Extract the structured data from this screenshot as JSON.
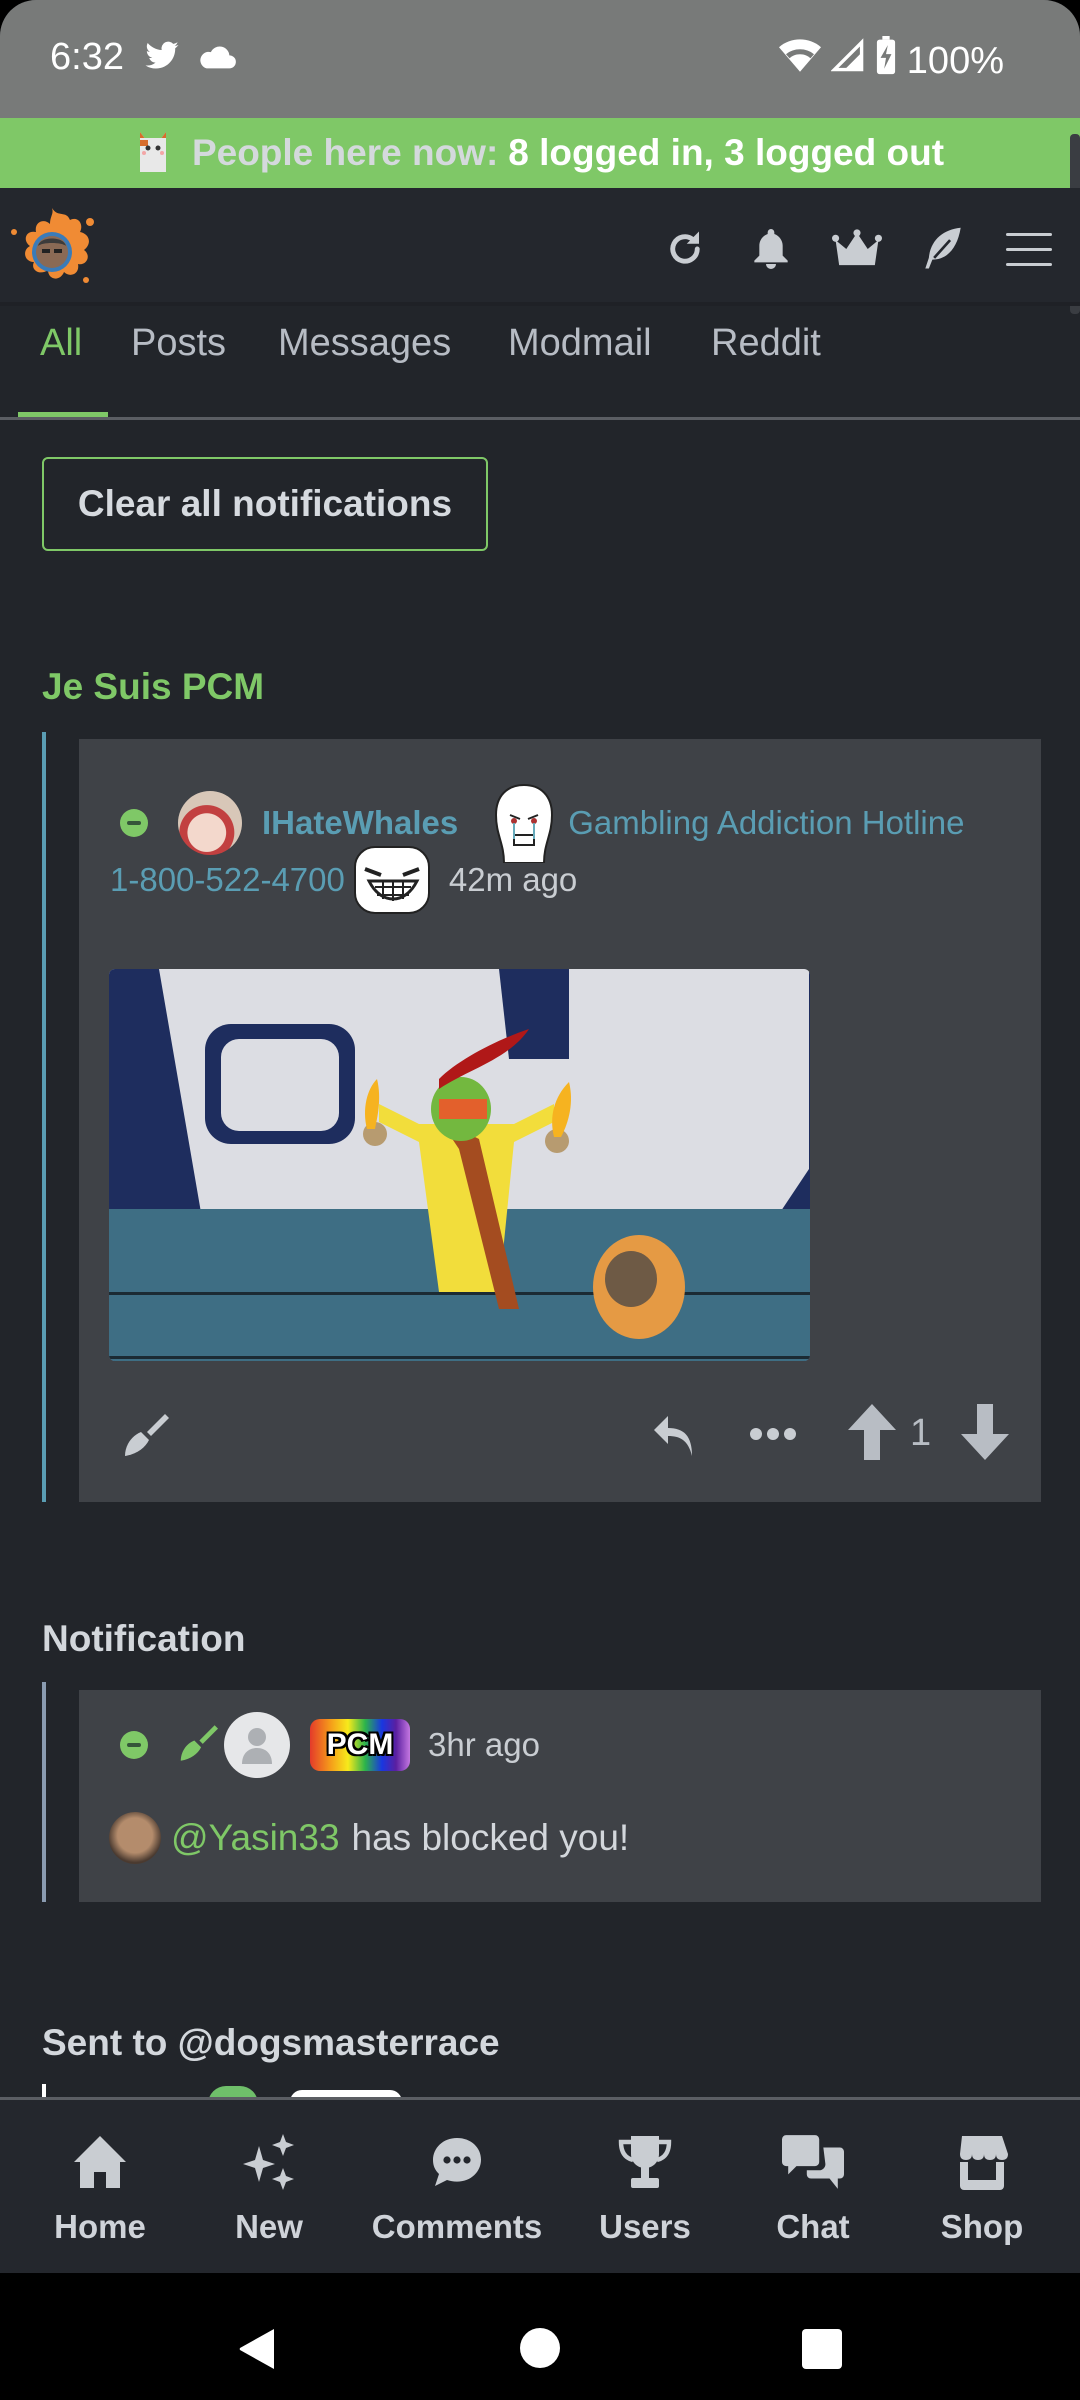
{
  "status_bar": {
    "time": "6:32",
    "left_icons": [
      "twitter-icon",
      "cloud-icon"
    ],
    "right_icons": [
      "wifi-icon",
      "signal-icon",
      "battery-charging-icon"
    ],
    "battery": "100%"
  },
  "banner": {
    "icon": "cat-mascot-icon",
    "prefix": "People here now:",
    "value": "8 logged in, 3 logged out",
    "color": "#7fc867"
  },
  "header": {
    "logo": "site-logo",
    "icons": [
      "refresh-icon",
      "bell-icon",
      "crown-icon",
      "feather-icon",
      "hamburger-menu-icon"
    ]
  },
  "tabs": [
    {
      "label": "All",
      "active": true
    },
    {
      "label": "Posts",
      "active": false
    },
    {
      "label": "Messages",
      "active": false
    },
    {
      "label": "Modmail",
      "active": false
    },
    {
      "label": "Reddit",
      "active": false
    }
  ],
  "clear_button": "Clear all notifications",
  "groups": [
    {
      "title": "Je Suis PCM",
      "item": {
        "username": "IHateWhales",
        "flair_line1": "Gambling Addiction Hotline",
        "flair_line2": "1-800-522-4700",
        "time": "42m ago",
        "has_image": true,
        "score": "1",
        "actions": [
          "sweep-icon",
          "reply-icon",
          "more-icon",
          "upvote-icon",
          "downvote-icon"
        ]
      }
    },
    {
      "title": "Notification",
      "item": {
        "badge": "PCM",
        "time": "3hr ago",
        "mention": "@Yasin33",
        "message": "has blocked you!"
      }
    },
    {
      "title": "Sent to @dogsmasterrace"
    }
  ],
  "bottom_nav": [
    {
      "label": "Home",
      "icon": "home-icon"
    },
    {
      "label": "New",
      "icon": "sparkles-icon"
    },
    {
      "label": "Comments",
      "icon": "comment-icon"
    },
    {
      "label": "Users",
      "icon": "trophy-icon"
    },
    {
      "label": "Chat",
      "icon": "chat-icon"
    },
    {
      "label": "Shop",
      "icon": "store-icon"
    }
  ],
  "colors": {
    "accent": "#7fc867",
    "link": "#5a9db3",
    "background": "#22252a",
    "card": "#3f4247"
  }
}
